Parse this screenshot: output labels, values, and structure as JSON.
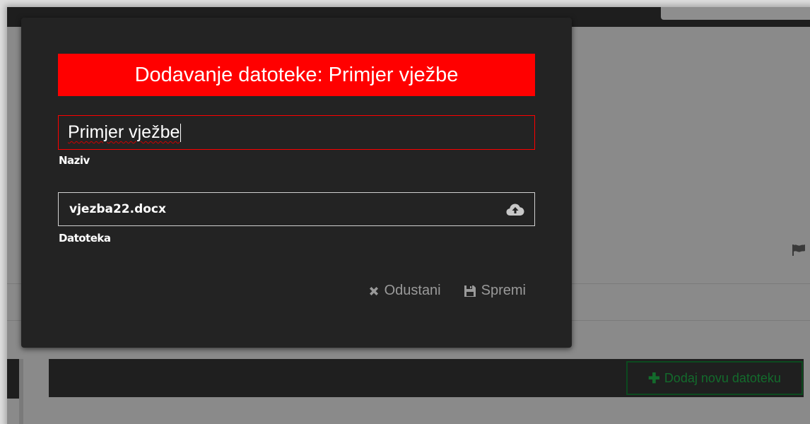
{
  "modal": {
    "title": "Dodavanje datoteke: Primjer vježbe",
    "name_value": "Primjer vježbe",
    "name_label": "Naziv",
    "file_value": "vjezba22.docx",
    "file_label": "Datoteka",
    "cancel_label": "Odustani",
    "save_label": "Spremi",
    "icons": {
      "upload": "cloud-upload-icon",
      "cancel": "close-icon",
      "save": "floppy-disk-icon"
    }
  },
  "background": {
    "add_button_label": "Dodaj novu datoteku",
    "icons": {
      "flag": "flag-icon",
      "plus": "plus-icon"
    }
  },
  "colors": {
    "accent": "#ff0000",
    "modal_bg": "#232323",
    "action_text": "#9a9a9a",
    "add_button": "#136b2c"
  }
}
